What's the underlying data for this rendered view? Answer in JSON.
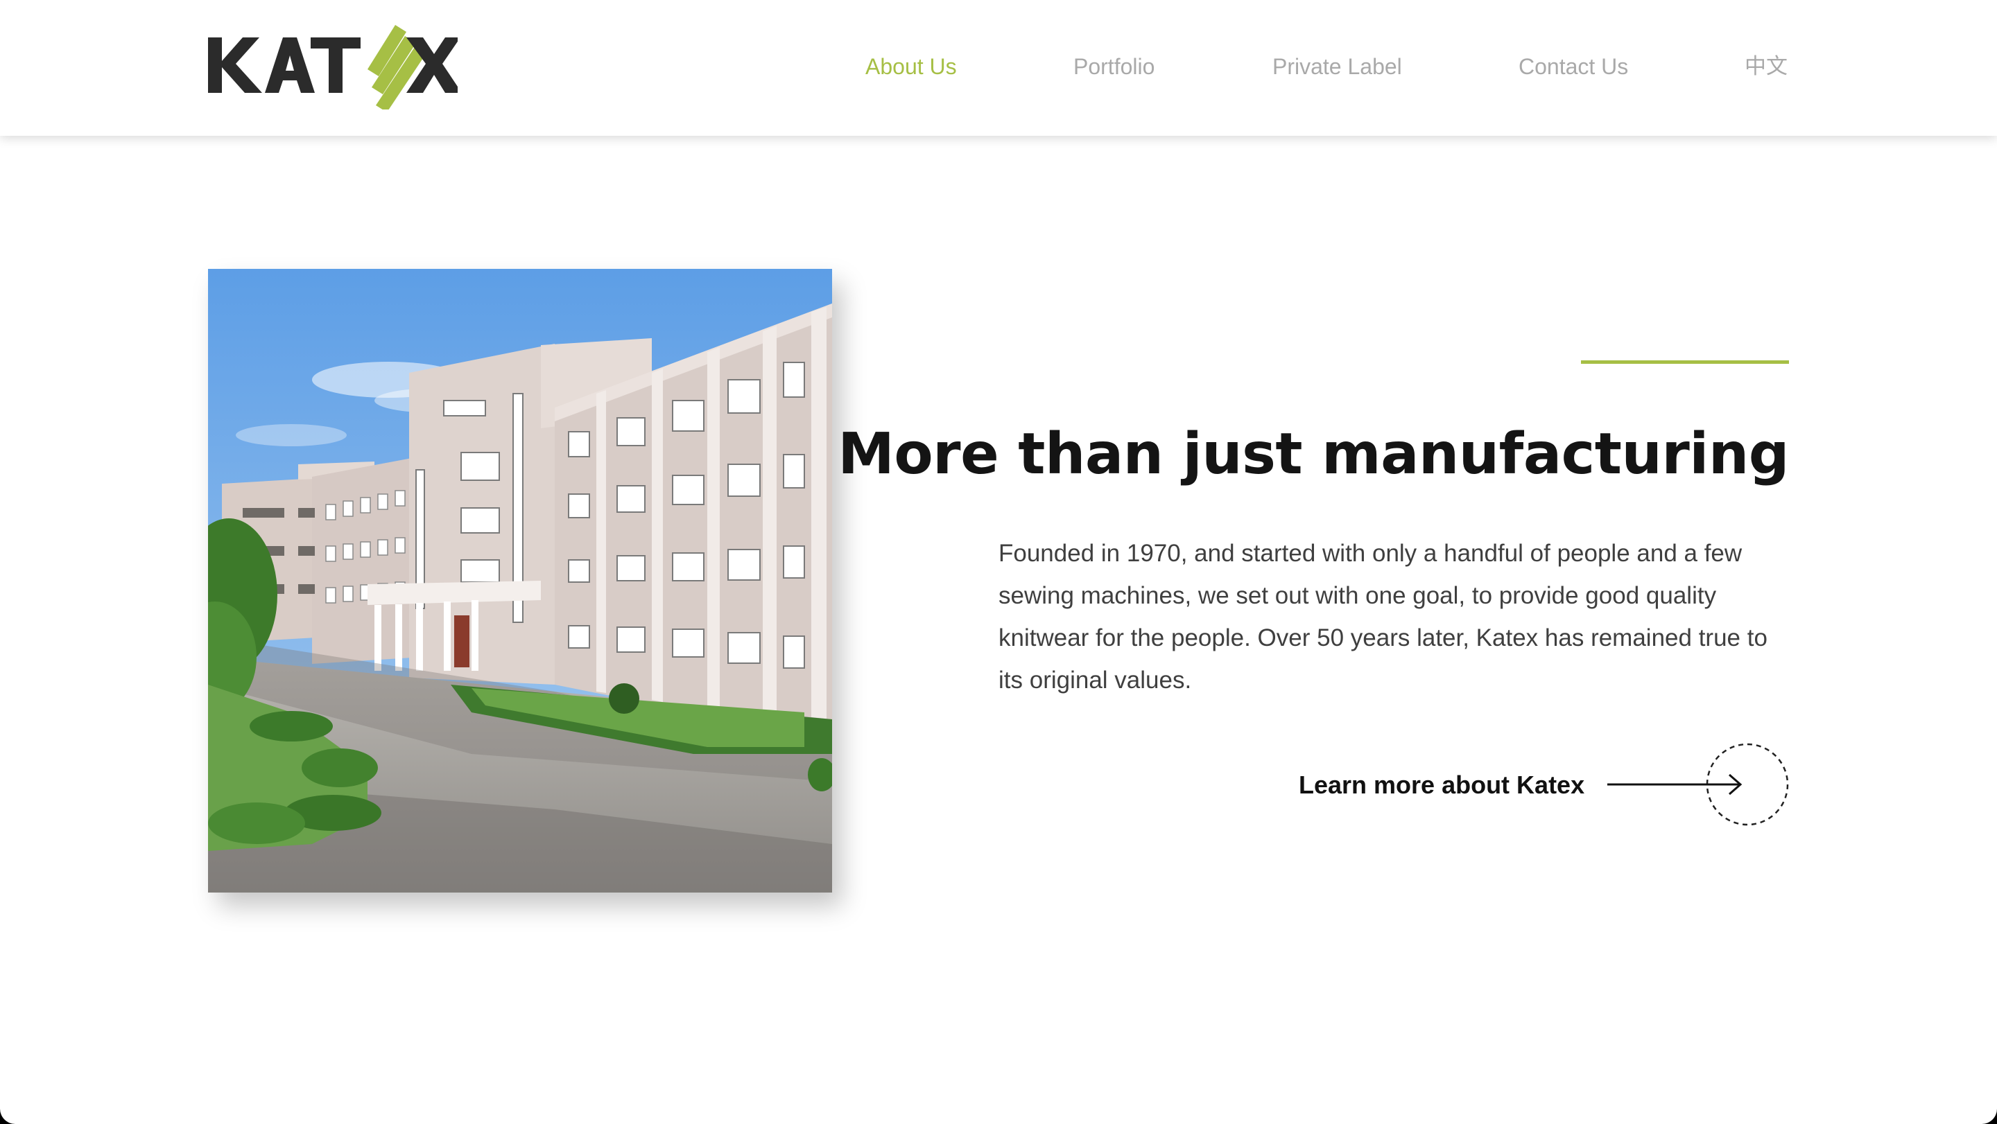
{
  "brand": {
    "logo_text": "KATEX",
    "accent_color": "#a6bf45",
    "dark_color": "#2b2b2b"
  },
  "nav": {
    "items": [
      {
        "label": "About Us",
        "active": true
      },
      {
        "label": "Portfolio",
        "active": false
      },
      {
        "label": "Private Label",
        "active": false
      },
      {
        "label": "Contact Us",
        "active": false
      },
      {
        "label": "中文",
        "active": false
      }
    ]
  },
  "hero": {
    "image_icon": "factory-building-photo",
    "headline": "More than just manufacturing",
    "body": "Founded in 1970, and started with only a handful of people and a few sewing machines, we set out with one goal, to provide good quality knitwear for the people. Over 50 years later, Katex has remained true to its original values.",
    "cta_label": "Learn more about Katex",
    "cta_icon": "arrow-right-circle-icon"
  }
}
